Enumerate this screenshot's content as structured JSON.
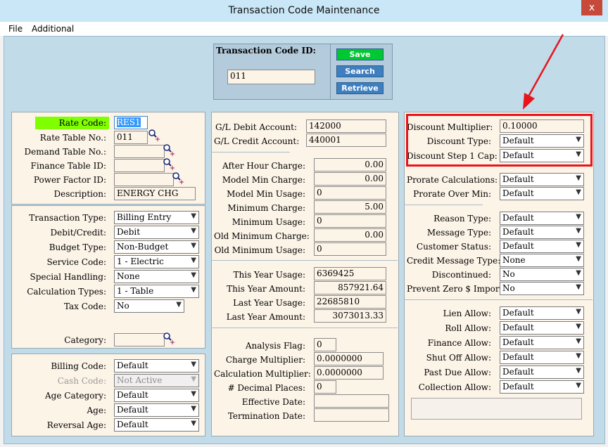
{
  "window": {
    "title": "Transaction Code Maintenance",
    "close": "x"
  },
  "menu": {
    "file": "File",
    "additional": "Additional"
  },
  "id_box": {
    "label": "Transaction Code ID:",
    "value": "011"
  },
  "buttons": {
    "save": "Save",
    "search": "Search",
    "retrieve": "Retrieve"
  },
  "left": {
    "rate_code": {
      "label": "Rate Code:",
      "value": "RES1"
    },
    "rate_table": {
      "label": "Rate Table No.:",
      "value": "011"
    },
    "demand_table": {
      "label": "Demand Table No.:",
      "value": ""
    },
    "finance_table": {
      "label": "Finance Table ID:",
      "value": ""
    },
    "power_factor": {
      "label": "Power Factor ID:",
      "value": ""
    },
    "description": {
      "label": "Description:",
      "value": "ENERGY CHG"
    },
    "transaction_type": {
      "label": "Transaction Type:",
      "value": "Billing Entry"
    },
    "debit_credit": {
      "label": "Debit/Credit:",
      "value": "Debit"
    },
    "budget_type": {
      "label": "Budget Type:",
      "value": "Non-Budget"
    },
    "service_code": {
      "label": "Service Code:",
      "value": "1 - Electric"
    },
    "special_handling": {
      "label": "Special Handling:",
      "value": "None"
    },
    "calculation_types": {
      "label": "Calculation Types:",
      "value": "1 - Table"
    },
    "tax_code": {
      "label": "Tax Code:",
      "value": "No"
    },
    "category": {
      "label": "Category:",
      "value": ""
    },
    "billing_code": {
      "label": "Billing Code:",
      "value": "Default"
    },
    "cash_code": {
      "label": "Cash Code:",
      "value": "Not Active"
    },
    "age_category": {
      "label": "Age Category:",
      "value": "Default"
    },
    "age": {
      "label": "Age:",
      "value": "Default"
    },
    "reversal_age": {
      "label": "Reversal Age:",
      "value": "Default"
    }
  },
  "middle": {
    "gl_debit": {
      "label": "G/L Debit Account:",
      "value": "142000"
    },
    "gl_credit": {
      "label": "G/L Credit Account:",
      "value": "440001"
    },
    "after_hour_charge": {
      "label": "After Hour Charge:",
      "value": "0.00"
    },
    "model_min_charge": {
      "label": "Model Min Charge:",
      "value": "0.00"
    },
    "model_min_usage": {
      "label": "Model Min Usage:",
      "value": "0"
    },
    "minimum_charge": {
      "label": "Minimum Charge:",
      "value": "5.00"
    },
    "minimum_usage": {
      "label": "Minimum Usage:",
      "value": "0"
    },
    "old_minimum_charge": {
      "label": "Old Minimum Charge:",
      "value": "0.00"
    },
    "old_minimum_usage": {
      "label": "Old Minimum Usage:",
      "value": "0"
    },
    "this_year_usage": {
      "label": "This Year Usage:",
      "value": "6369425"
    },
    "this_year_amount": {
      "label": "This Year Amount:",
      "value": "857921.64"
    },
    "last_year_usage": {
      "label": "Last Year Usage:",
      "value": "22685810"
    },
    "last_year_amount": {
      "label": "Last Year Amount:",
      "value": "3073013.33"
    },
    "analysis_flag": {
      "label": "Analysis Flag:",
      "value": "0"
    },
    "charge_multiplier": {
      "label": "Charge Multiplier:",
      "value": "0.0000000"
    },
    "calculation_multiplier": {
      "label": "Calculation Multiplier:",
      "value": "0.0000000"
    },
    "decimal_places": {
      "label": "# Decimal Places:",
      "value": "0"
    },
    "effective_date": {
      "label": "Effective Date:",
      "value": ""
    },
    "termination_date": {
      "label": "Termination Date:",
      "value": ""
    }
  },
  "right": {
    "discount_multiplier": {
      "label": "Discount Multiplier:",
      "value": "0.10000"
    },
    "discount_type": {
      "label": "Discount Type:",
      "value": "Default"
    },
    "discount_step_cap": {
      "label": "Discount Step 1 Cap:",
      "value": "Default"
    },
    "prorate_calculations": {
      "label": "Prorate Calculations:",
      "value": "Default"
    },
    "prorate_over_min": {
      "label": "Prorate Over Min:",
      "value": "Default"
    },
    "reason_type": {
      "label": "Reason Type:",
      "value": "Default"
    },
    "message_type": {
      "label": "Message Type:",
      "value": "Default"
    },
    "customer_status": {
      "label": "Customer Status:",
      "value": "Default"
    },
    "credit_message_type": {
      "label": "Credit Message Type:",
      "value": "None"
    },
    "discontinued": {
      "label": "Discontinued:",
      "value": "No"
    },
    "prevent_zero_import": {
      "label": "Prevent Zero $ Import:",
      "value": "No"
    },
    "lien_allow": {
      "label": "Lien Allow:",
      "value": "Default"
    },
    "roll_allow": {
      "label": "Roll Allow:",
      "value": "Default"
    },
    "finance_allow": {
      "label": "Finance Allow:",
      "value": "Default"
    },
    "shut_off_allow": {
      "label": "Shut Off Allow:",
      "value": "Default"
    },
    "past_due_allow": {
      "label": "Past Due Allow:",
      "value": "Default"
    },
    "collection_allow": {
      "label": "Collection Allow:",
      "value": "Default"
    }
  },
  "colors": {
    "highlight_label": "#7fff00",
    "annotation": "#e8141b",
    "save_button": "#00c832",
    "action_button": "#3f7fbf"
  },
  "icons": {
    "dropdown": "chevron-down-icon",
    "lookup": "magnifier-icon",
    "close": "close-icon"
  }
}
